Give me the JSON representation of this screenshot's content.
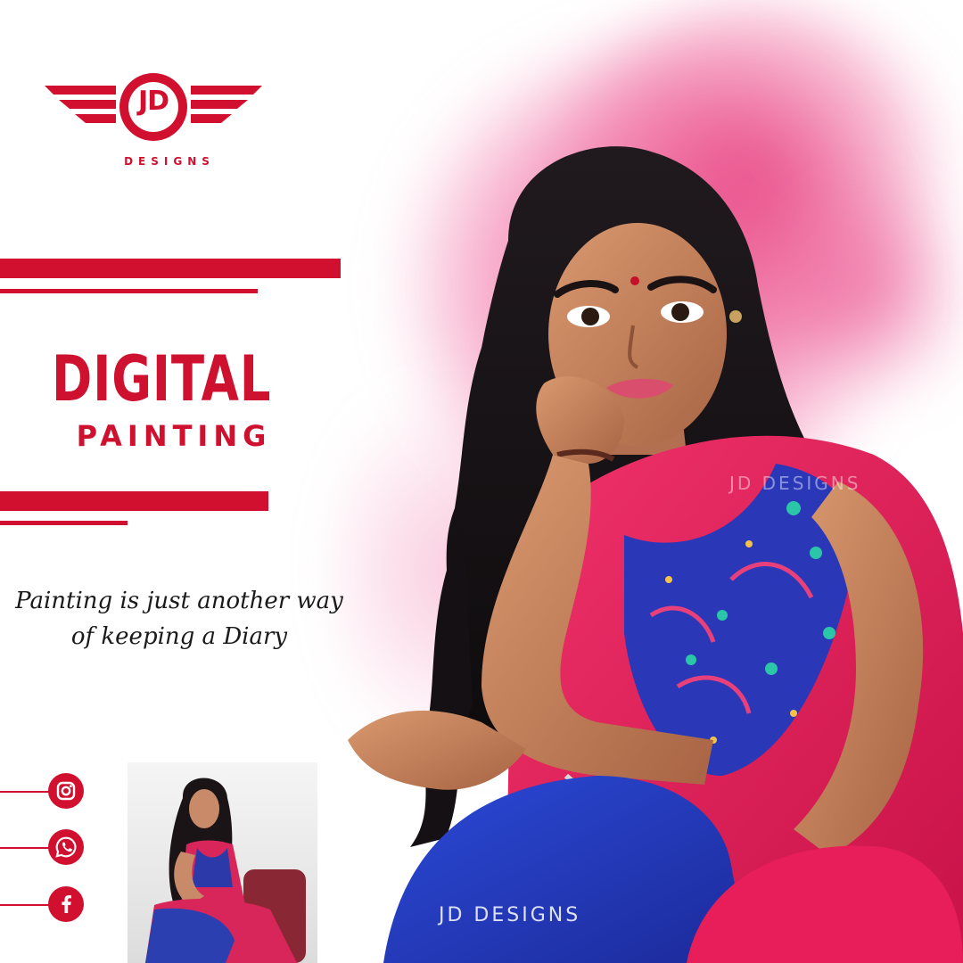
{
  "brand": {
    "logo_letters": "JD",
    "logo_subtext": "DESIGNS",
    "accent_color": "#d0102e"
  },
  "headline": {
    "line1": "DIGITAL",
    "line2": "PAINTING"
  },
  "quote": {
    "line1": "Painting is just another way",
    "line2": "of keeping a Diary"
  },
  "social": [
    {
      "icon": "instagram-icon"
    },
    {
      "icon": "whatsapp-icon"
    },
    {
      "icon": "facebook-icon"
    }
  ],
  "watermark": "JD DESIGNS",
  "watermark_faint": "JD DESIGNS"
}
